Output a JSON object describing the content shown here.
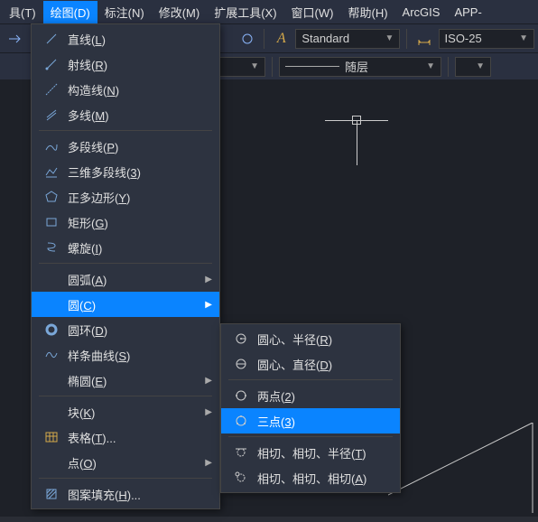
{
  "menubar": {
    "items": [
      {
        "label": "具(T)",
        "key": "T"
      },
      {
        "label": "绘图(D)",
        "key": "D",
        "active": true
      },
      {
        "label": "标注(N)",
        "key": "N"
      },
      {
        "label": "修改(M)",
        "key": "M"
      },
      {
        "label": "扩展工具(X)",
        "key": "X"
      },
      {
        "label": "窗口(W)",
        "key": "W"
      },
      {
        "label": "帮助(H)",
        "key": "H"
      },
      {
        "label": "ArcGIS",
        "key": ""
      },
      {
        "label": "APP-",
        "key": ""
      }
    ]
  },
  "toolbar": {
    "style1": "Standard",
    "style2": "ISO-25"
  },
  "toolbar2": {
    "layer": "随层"
  },
  "drawMenu": {
    "items": [
      {
        "label": "直线(",
        "u": "L",
        "tail": ")",
        "icon": "line-icon"
      },
      {
        "label": "射线(",
        "u": "R",
        "tail": ")",
        "icon": "ray-icon"
      },
      {
        "label": "构造线(",
        "u": "N",
        "tail": ")",
        "icon": "xline-icon"
      },
      {
        "label": "多线(",
        "u": "M",
        "tail": ")",
        "icon": "mline-icon"
      },
      {
        "sep": true
      },
      {
        "label": "多段线(",
        "u": "P",
        "tail": ")",
        "icon": "pline-icon"
      },
      {
        "label": "三维多段线(",
        "u": "3",
        "tail": ")",
        "icon": "3dpoly-icon"
      },
      {
        "label": "正多边形(",
        "u": "Y",
        "tail": ")",
        "icon": "polygon-icon"
      },
      {
        "label": "矩形(",
        "u": "G",
        "tail": ")",
        "icon": "rect-icon"
      },
      {
        "label": "螺旋(",
        "u": "I",
        "tail": ")",
        "icon": "helix-icon"
      },
      {
        "sep": true
      },
      {
        "label": "圆弧(",
        "u": "A",
        "tail": ")",
        "icon": "",
        "sub": true
      },
      {
        "label": "圆(",
        "u": "C",
        "tail": ")",
        "icon": "",
        "sub": true,
        "hi": true
      },
      {
        "label": "圆环(",
        "u": "D",
        "tail": ")",
        "icon": "donut-icon"
      },
      {
        "label": "样条曲线(",
        "u": "S",
        "tail": ")",
        "icon": "spline-icon"
      },
      {
        "label": "椭圆(",
        "u": "E",
        "tail": ")",
        "icon": "",
        "sub": true
      },
      {
        "sep": true
      },
      {
        "label": "块(",
        "u": "K",
        "tail": ")",
        "icon": "",
        "sub": true
      },
      {
        "label": "表格(",
        "u": "T",
        "tail": ")...",
        "icon": "table-icon"
      },
      {
        "label": "点(",
        "u": "O",
        "tail": ")",
        "icon": "",
        "sub": true
      },
      {
        "sep": true
      },
      {
        "label": "图案填充(",
        "u": "H",
        "tail": ")...",
        "icon": "hatch-icon"
      }
    ]
  },
  "circleSub": {
    "items": [
      {
        "label": "圆心、半径(",
        "u": "R",
        "tail": ")",
        "icon": "circle-cr-icon"
      },
      {
        "label": "圆心、直径(",
        "u": "D",
        "tail": ")",
        "icon": "circle-cd-icon"
      },
      {
        "sep": true
      },
      {
        "label": "两点(",
        "u": "2",
        "tail": ")",
        "icon": "circle-2p-icon"
      },
      {
        "label": "三点(",
        "u": "3",
        "tail": ")",
        "icon": "circle-3p-icon",
        "hi": true
      },
      {
        "sep": true
      },
      {
        "label": "相切、相切、半径(",
        "u": "T",
        "tail": ")",
        "icon": "circle-ttr-icon"
      },
      {
        "label": "相切、相切、相切(",
        "u": "A",
        "tail": ")",
        "icon": "circle-ttt-icon"
      }
    ]
  }
}
